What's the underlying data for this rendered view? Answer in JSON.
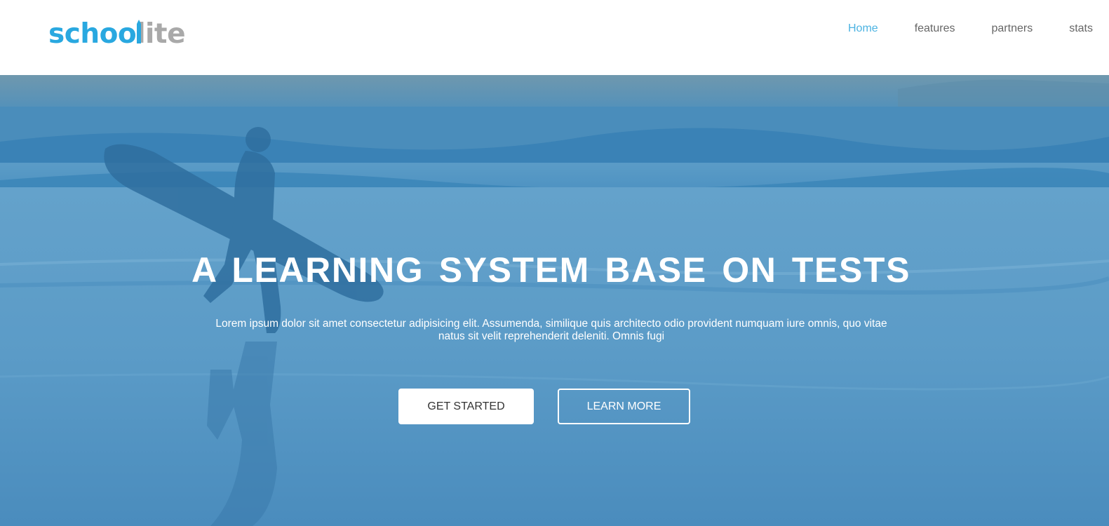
{
  "header": {
    "logo": {
      "part1": "schoo",
      "part2": "lite",
      "color1": "#29a8e0",
      "color2": "#a9a9a9"
    },
    "nav": [
      {
        "label": "Home",
        "active": true
      },
      {
        "label": "features",
        "active": false
      },
      {
        "label": "partners",
        "active": false
      },
      {
        "label": "stats",
        "active": false
      }
    ],
    "active_color": "#4cb3e2"
  },
  "hero": {
    "title": "A LEARNING SYSTEM BASE ON TESTS",
    "text": "Lorem ipsum dolor sit amet consectetur adipisicing elit. Assumenda, similique quis architecto odio provident numquam iure omnis, quo vitae natus sit velit reprehenderit deleniti. Omnis fugi",
    "primary_button": "GET STARTED",
    "secondary_button": "LEARN MORE",
    "background_image": "surfer-silhouette-on-beach",
    "overlay_color": "#4a8fc0"
  }
}
